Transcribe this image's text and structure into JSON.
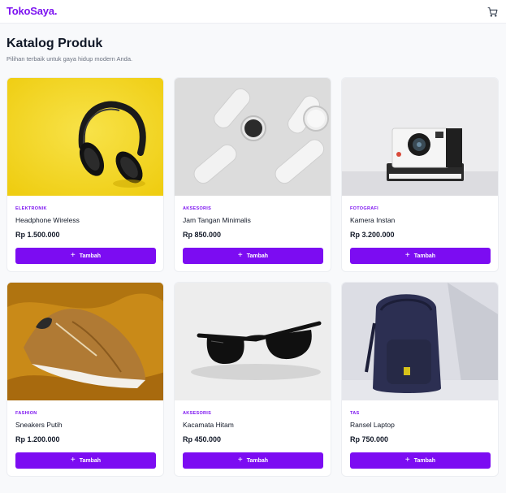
{
  "app": {
    "brand": "TokoSaya."
  },
  "header": {
    "cart_icon": "shopping-cart-icon"
  },
  "page": {
    "title": "Katalog Produk",
    "subtitle": "Pilihan terbaik untuk gaya hidup modern Anda."
  },
  "colors": {
    "accent": "#7c0cf2",
    "background": "#f8f9fb"
  },
  "products": [
    {
      "category": "ELEKTRONIK",
      "name": "Headphone Wireless",
      "price": "Rp 1.500.000",
      "button_label": "Tambah",
      "image_icon": "headphone-image"
    },
    {
      "category": "AKSESORIS",
      "name": "Jam Tangan Minimalis",
      "price": "Rp 850.000",
      "button_label": "Tambah",
      "image_icon": "watch-image"
    },
    {
      "category": "FOTOGRAFI",
      "name": "Kamera Instan",
      "price": "Rp 3.200.000",
      "button_label": "Tambah",
      "image_icon": "camera-image"
    },
    {
      "category": "FASHION",
      "name": "Sneakers Putih",
      "price": "Rp 1.200.000",
      "button_label": "Tambah",
      "image_icon": "sneakers-image"
    },
    {
      "category": "AKSESORIS",
      "name": "Kacamata Hitam",
      "price": "Rp 450.000",
      "button_label": "Tambah",
      "image_icon": "sunglasses-image"
    },
    {
      "category": "TAS",
      "name": "Ransel Laptop",
      "price": "Rp 750.000",
      "button_label": "Tambah",
      "image_icon": "backpack-image"
    }
  ]
}
